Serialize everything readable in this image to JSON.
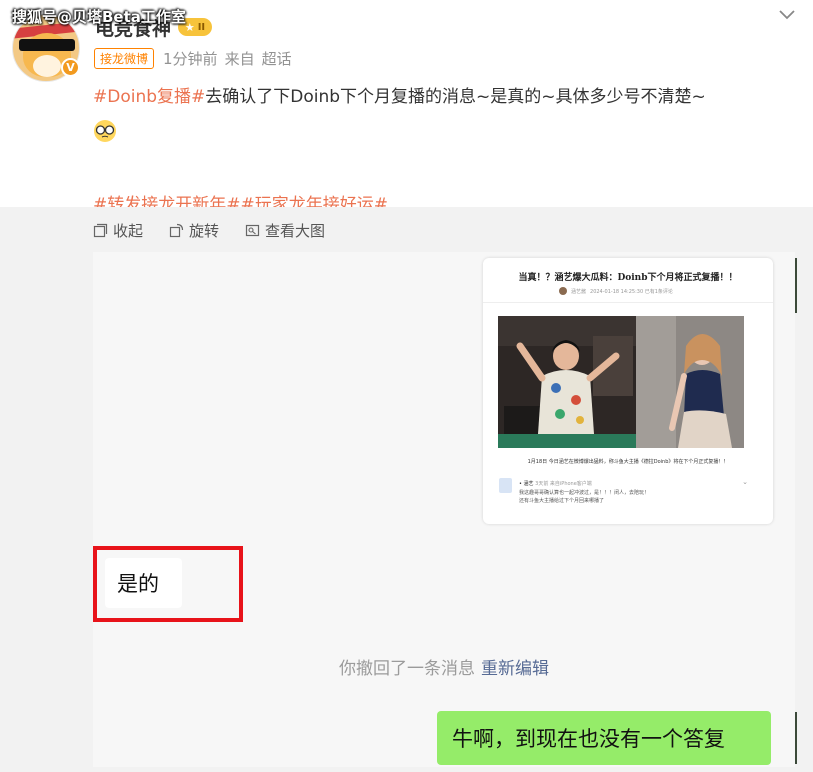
{
  "watermark": "搜狐号@贝塔Beta工作室",
  "user": {
    "name": "电竞食神",
    "level": "II",
    "verified_badge": "V"
  },
  "meta": {
    "tag": "接龙微博",
    "time": "1分钟前",
    "source_prefix": "来自",
    "source": "超话"
  },
  "post": {
    "topic1": "#Doinb复播#",
    "text1": "去确认了下Doinb下个月复播的消息~是真的~具体多少号不清楚~",
    "emoji": "glasses-emoji",
    "topic2": "#转发接龙开新年#",
    "topic3": "#玩家龙年接好运#"
  },
  "toolbar": {
    "collapse": "收起",
    "rotate": "旋转",
    "view_large": "查看大图"
  },
  "chat": {
    "screenshot_card": {
      "title": "当真！？涵艺爆大瓜料：Doinb下个月将正式复播！！",
      "author": "涵艺酱",
      "meta_text": "2024-01-18 14:25:30  已有1条评论",
      "caption": "1月18日 今日涵艺在微博爆出猛料，称斗鱼大主播《德拉Doinb》将在下个月正式复播！！",
      "comment_name": "• 涵艺",
      "comment_meta": "3天前 来自iPhone客户端",
      "comment_line1": "我这趣哥哥确认算也一起冲波过，是！！！闭人，去陪玩！",
      "comment_line2": "还有斗鱼大主播给过下个月回来哪播了"
    },
    "bubble_left": "是的",
    "recall_text": "你撤回了一条消息",
    "re_edit": "重新编辑",
    "bubble_right": "牛啊，到现在也没有一个答复"
  },
  "colors": {
    "topic": "#eb7350",
    "tag": "#ff8200",
    "highlight_box": "#e8131a",
    "wechat_green": "#95ec69",
    "link_blue": "#576b95"
  }
}
